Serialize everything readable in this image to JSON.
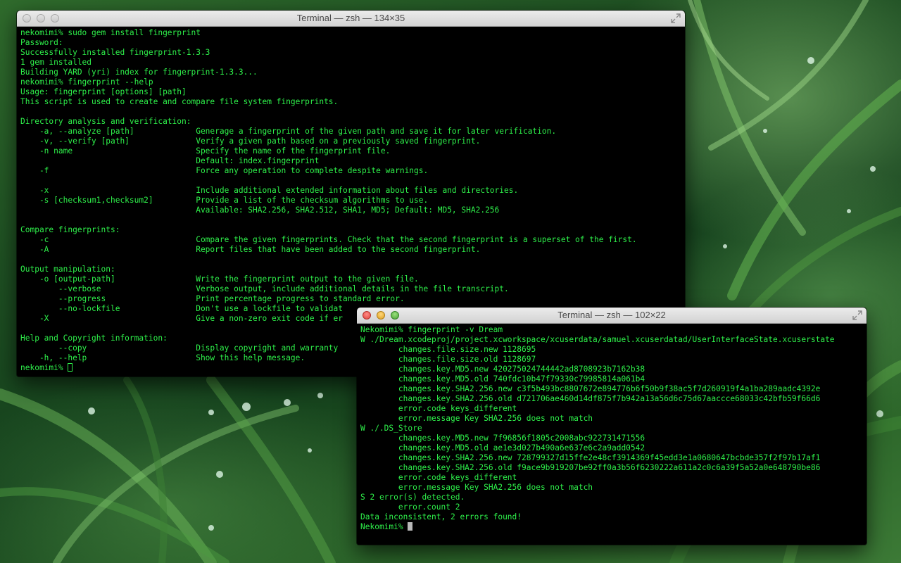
{
  "desktop": {
    "wallpaper_icon": "grass-wallpaper"
  },
  "windows": [
    {
      "title": "Terminal — zsh — 134×35",
      "lines": [
        "nekomimi% sudo gem install fingerprint",
        "Password:",
        "Successfully installed fingerprint-1.3.3",
        "1 gem installed",
        "Building YARD (yri) index for fingerprint-1.3.3...",
        "nekomimi% fingerprint --help",
        "Usage: fingerprint [options] [path]",
        "This script is used to create and compare file system fingerprints.",
        "",
        "Directory analysis and verification:",
        "    -a, --analyze [path]             Generage a fingerprint of the given path and save it for later verification.",
        "    -v, --verify [path]              Verify a given path based on a previously saved fingerprint.",
        "    -n name                          Specify the name of the fingerprint file.",
        "                                     Default: index.fingerprint",
        "    -f                               Force any operation to complete despite warnings.",
        "",
        "    -x                               Include additional extended information about files and directories.",
        "    -s [checksum1,checksum2]         Provide a list of the checksum algorithms to use.",
        "                                     Available: SHA2.256, SHA2.512, SHA1, MD5; Default: MD5, SHA2.256",
        "",
        "Compare fingerprints:",
        "    -c                               Compare the given fingerprints. Check that the second fingerprint is a superset of the first.",
        "    -A                               Report files that have been added to the second fingerprint.",
        "",
        "Output manipulation:",
        "    -o [output-path]                 Write the fingerprint output to the given file.",
        "        --verbose                    Verbose output, include additional details in the file transcript.",
        "        --progress                   Print percentage progress to standard error.",
        "        --no-lockfile                Don't use a lockfile to validat",
        "    -X                               Give a non-zero exit code if er",
        "",
        "Help and Copyright information:",
        "        --copy                       Display copyright and warranty",
        "    -h, --help                       Show this help message."
      ],
      "prompt": "nekomimi% "
    },
    {
      "title": "Terminal — zsh — 102×22",
      "lines": [
        "Nekomimi% fingerprint -v Dream",
        "W ./Dream.xcodeproj/project.xcworkspace/xcuserdata/samuel.xcuserdatad/UserInterfaceState.xcuserstate",
        "        changes.file.size.new 1128695",
        "        changes.file.size.old 1128697",
        "        changes.key.MD5.new 420275024744442ad8708923b7162b38",
        "        changes.key.MD5.old 740fdc10b47f79330c79985814a061b4",
        "        changes.key.SHA2.256.new c3f5b493bc8807672e894776b6f50b9f38ac5f7d260919f4a1ba289aadc4392e",
        "        changes.key.SHA2.256.old d721706ae460d14df875f7b942a13a56d6c75d67aaccce68033c42bfb59f66d6",
        "        error.code keys_different",
        "        error.message Key SHA2.256 does not match",
        "W ./.DS_Store",
        "        changes.key.MD5.new 7f96856f1805c2008abc922731471556",
        "        changes.key.MD5.old ae1e3d027b490a6e637e6c2a9add0542",
        "        changes.key.SHA2.256.new 728799327d15ffe2e48cf3914369f45edd3e1a0680647bcbde357f2f97b17af1",
        "        changes.key.SHA2.256.old f9ace9b919207be92ff0a3b56f6230222a611a2c0c6a39f5a52a0e648790be86",
        "        error.code keys_different",
        "        error.message Key SHA2.256 does not match",
        "S 2 error(s) detected.",
        "        error.count 2",
        "Data inconsistent, 2 errors found!"
      ],
      "prompt": "Nekomimi% "
    }
  ],
  "colors": {
    "terminal_text": "#2ef04a",
    "terminal_background": "#000000"
  }
}
